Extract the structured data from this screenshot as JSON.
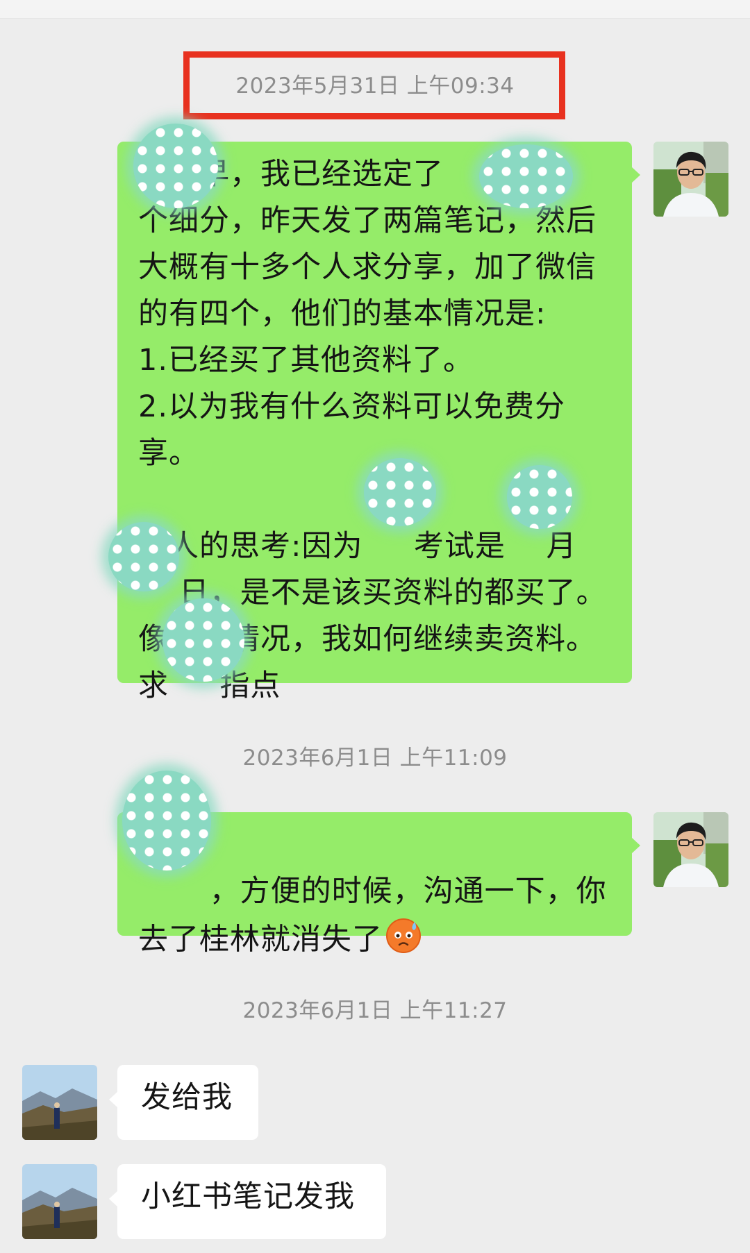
{
  "chat": {
    "ts1": "2023年5月31日 上午09:34",
    "ts2": "2023年6月1日 上午11:09",
    "ts3": "2023年6月1日 上午11:27",
    "msg1": "      早，我已经选定了     这\n个细分，昨天发了两篇笔记，然后\n大概有十多个人求分享，加了微信\n的有四个，他们的基本情况是:\n1.已经买了其他资料了。\n2.以为我有什么资料可以免费分享。\n\n个人的思考:因为     考试是    月\n    日，是不是该买资料的都买了。\n像这种情况，我如何继续卖资料。\n求     指点",
    "msg2": "     ，方便的时候，沟通一下，你\n去了桂林就消失了",
    "msg3": "发给我",
    "msg4": "小红书笔记发我"
  },
  "icons": {
    "emoji": "sweat-face-emoji",
    "redaction": "polka-dot-mosaic"
  },
  "colors": {
    "out_bubble": "#95ec69",
    "in_bubble": "#ffffff",
    "background": "#ededed",
    "highlight": "#e8311f"
  }
}
